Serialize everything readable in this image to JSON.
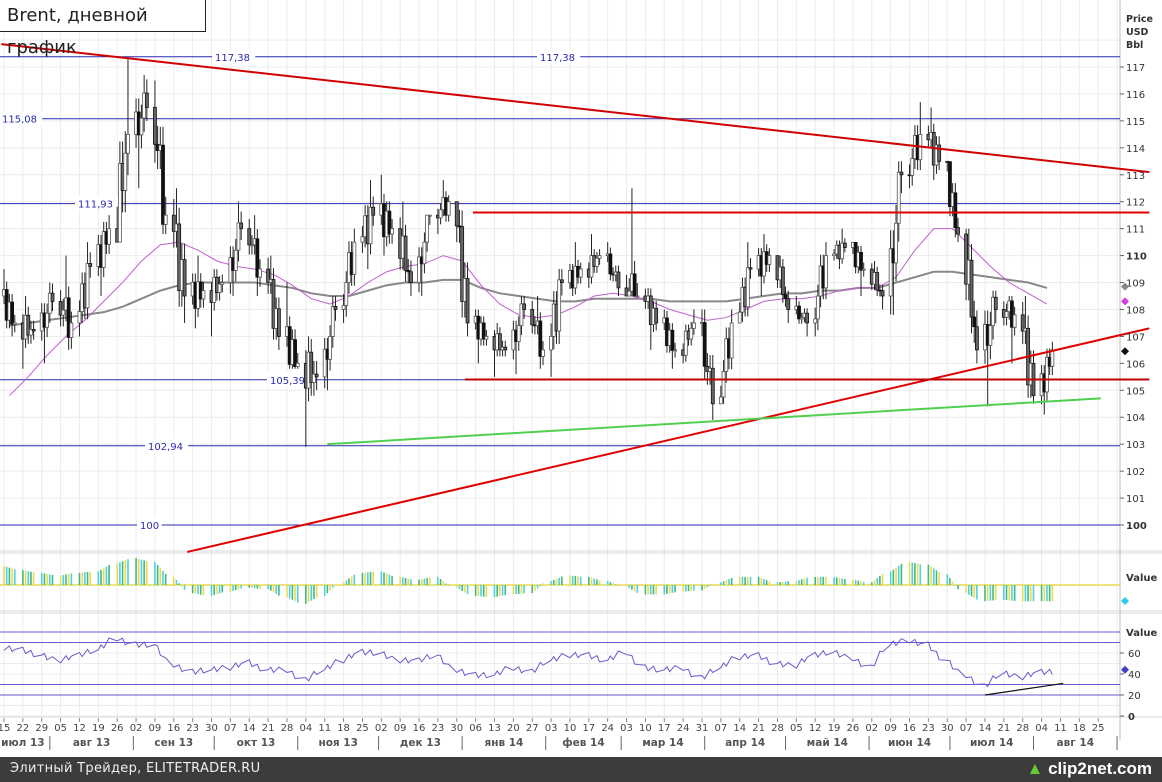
{
  "header": {
    "title": "Brent, дневной график"
  },
  "footer": {
    "source": "Элитный Трейдер, ELITETRADER.RU",
    "logo": "clip2net.com"
  },
  "chart_data": {
    "type": "candlestick",
    "title": "Brent, дневной график",
    "ylabel": "Price USD Bbl",
    "ylim": [
      99,
      118.5
    ],
    "y_ticks": [
      "117",
      "116",
      "115",
      "114",
      "113",
      "112",
      "111",
      "110",
      "109",
      "108",
      "107",
      "106",
      "105",
      "104",
      "103",
      "102",
      "101",
      "100"
    ],
    "start_week": "2013-07-15",
    "weekly_ohlc": [
      [
        108.5,
        109.5,
        107,
        107.5
      ],
      [
        107.5,
        108.5,
        105.8,
        107.2
      ],
      [
        107.2,
        109,
        106,
        108.3
      ],
      [
        108.3,
        110,
        106.5,
        107.5
      ],
      [
        107.5,
        110.5,
        107,
        109.6
      ],
      [
        109.6,
        111.5,
        108.5,
        111
      ],
      [
        111,
        117.3,
        110.5,
        114.5
      ],
      [
        114.5,
        116.7,
        112.5,
        115.5
      ],
      [
        115.5,
        116.5,
        110.8,
        111.5
      ],
      [
        111.5,
        112.5,
        107.5,
        108.5
      ],
      [
        108.5,
        110,
        107.3,
        108.7
      ],
      [
        108.7,
        109.5,
        107,
        109
      ],
      [
        109,
        112,
        108.5,
        111
      ],
      [
        111,
        111.5,
        108.5,
        109.5
      ],
      [
        109.5,
        110,
        106.5,
        107
      ],
      [
        107,
        109,
        105.8,
        106
      ],
      [
        106,
        107,
        102.9,
        105.5
      ],
      [
        105.5,
        108.5,
        105,
        108
      ],
      [
        108,
        111,
        107.5,
        110.5
      ],
      [
        110.5,
        112.8,
        109.5,
        111.5
      ],
      [
        111.5,
        113,
        110,
        111
      ],
      [
        111,
        112,
        108.5,
        109
      ],
      [
        109,
        111.5,
        108.5,
        111.5
      ],
      [
        111.5,
        112.8,
        110.8,
        112
      ],
      [
        112,
        112,
        107,
        107.5
      ],
      [
        107.5,
        108,
        106,
        107
      ],
      [
        107,
        107.5,
        105.5,
        106.5
      ],
      [
        106.5,
        108.5,
        105.6,
        108
      ],
      [
        108,
        108.5,
        105.8,
        106.5
      ],
      [
        106.5,
        109.5,
        105.5,
        109
      ],
      [
        109,
        110.5,
        108.5,
        109.5
      ],
      [
        109.5,
        110.8,
        108.8,
        110
      ],
      [
        110,
        110.5,
        108.5,
        108.8
      ],
      [
        108.8,
        112.5,
        108.5,
        108.5
      ],
      [
        108.5,
        108.8,
        106.5,
        107.5
      ],
      [
        107.5,
        108,
        105.8,
        106.5
      ],
      [
        106.5,
        108,
        106,
        107.5
      ],
      [
        107.5,
        108,
        103.9,
        104.5
      ],
      [
        104.5,
        108,
        104.5,
        107.5
      ],
      [
        107.5,
        110.5,
        107.5,
        109.5
      ],
      [
        109.5,
        110.8,
        108.5,
        110
      ],
      [
        110,
        110,
        107.5,
        108
      ],
      [
        108,
        108.5,
        107,
        107.5
      ],
      [
        107.5,
        110.5,
        107,
        110
      ],
      [
        110,
        111,
        109.5,
        110.3
      ],
      [
        110.3,
        110.5,
        108.5,
        109.5
      ],
      [
        109.5,
        109.8,
        108,
        108.5
      ],
      [
        108.5,
        113.5,
        107.8,
        113
      ],
      [
        113,
        115.7,
        112.5,
        114.5
      ],
      [
        114.5,
        115.5,
        112.8,
        113.5
      ],
      [
        113.5,
        113.5,
        110.5,
        110.8
      ],
      [
        110.8,
        111,
        106,
        106.5
      ],
      [
        106.5,
        108.7,
        104.4,
        108
      ],
      [
        108,
        108.5,
        106,
        107.8
      ],
      [
        107.8,
        108.5,
        104.5,
        104.8
      ],
      [
        104.8,
        106.8,
        104.1,
        106.5
      ]
    ],
    "ma_long_weekly": [
      107.4,
      107.5,
      107.6,
      107.7,
      107.8,
      107.9,
      108.1,
      108.4,
      108.7,
      108.9,
      109.0,
      109.0,
      109.0,
      109.0,
      108.9,
      108.8,
      108.6,
      108.5,
      108.5,
      108.7,
      108.9,
      109.0,
      109.0,
      109.1,
      109.1,
      108.8,
      108.6,
      108.5,
      108.4,
      108.3,
      108.3,
      108.4,
      108.4,
      108.4,
      108.4,
      108.3,
      108.3,
      108.3,
      108.3,
      108.4,
      108.5,
      108.6,
      108.6,
      108.7,
      108.7,
      108.8,
      108.8,
      109.0,
      109.2,
      109.4,
      109.4,
      109.3,
      109.2,
      109.1,
      109.0,
      108.8
    ],
    "ma_short_weekly": [
      104.8,
      105.5,
      106.3,
      107.0,
      107.6,
      108.3,
      109.0,
      109.8,
      110.4,
      110.5,
      110.2,
      109.8,
      109.6,
      109.5,
      109.3,
      108.9,
      108.4,
      108.2,
      108.5,
      109.0,
      109.4,
      109.6,
      109.7,
      110.0,
      109.8,
      108.9,
      108.2,
      107.8,
      107.7,
      107.8,
      108.1,
      108.5,
      108.6,
      108.5,
      108.3,
      108.0,
      107.8,
      107.6,
      107.7,
      108.0,
      108.3,
      108.4,
      108.4,
      108.5,
      108.7,
      108.8,
      108.8,
      109.2,
      110.2,
      111.0,
      111.0,
      110.3,
      109.6,
      109.0,
      108.6,
      108.2
    ],
    "levels": [
      {
        "value": 117.38,
        "labels": [
          "117,38",
          "117,38"
        ]
      },
      {
        "value": 115.08,
        "labels": [
          "115,08"
        ]
      },
      {
        "value": 111.93,
        "labels": [
          "111,93"
        ]
      },
      {
        "value": 105.39,
        "labels": [
          "105,39"
        ]
      },
      {
        "value": 102.94,
        "labels": [
          "102,94"
        ]
      },
      {
        "value": 100,
        "labels": [
          "100"
        ]
      }
    ],
    "trendlines": [
      {
        "name": "resistance-downtrend",
        "color": "#d00000",
        "from": [
          "2013-07-14",
          117.85
        ],
        "to": [
          "2014-09-13",
          113.1
        ]
      },
      {
        "name": "support-uptrend",
        "color": "#e00000",
        "from": [
          "2013-09-21",
          99.0
        ],
        "to": [
          "2014-09-13",
          107.3
        ]
      },
      {
        "name": "support-green",
        "color": "#50d050",
        "from": [
          "2013-11-12",
          103.0
        ],
        "to": [
          "2014-08-26",
          104.7
        ]
      },
      {
        "name": "resistance-horizontal",
        "color": "#e00000",
        "from": [
          "2014-01-05",
          111.6
        ],
        "to": [
          "2014-09-13",
          111.6
        ]
      },
      {
        "name": "support-horizontal",
        "color": "#c00000",
        "from": [
          "2014-01-02",
          105.4
        ],
        "to": [
          "2014-09-13",
          105.4
        ]
      }
    ],
    "oscillator": {
      "label": "Value",
      "weekly": [
        0.7,
        0.55,
        0.45,
        0.35,
        0.45,
        0.5,
        0.8,
        1.0,
        0.85,
        0.3,
        -0.3,
        -0.4,
        -0.25,
        -0.1,
        -0.15,
        -0.45,
        -0.7,
        -0.4,
        0.1,
        0.45,
        0.5,
        0.3,
        0.2,
        0.3,
        -0.1,
        -0.4,
        -0.45,
        -0.35,
        -0.3,
        0.15,
        0.35,
        0.3,
        0.15,
        -0.05,
        -0.35,
        -0.35,
        -0.25,
        -0.2,
        0.1,
        0.3,
        0.3,
        0.1,
        0.15,
        0.3,
        0.3,
        0.2,
        0.1,
        0.5,
        0.85,
        0.75,
        0.4,
        -0.3,
        -0.6,
        -0.55,
        -0.6,
        -0.6
      ]
    },
    "rsi": {
      "label": "Value",
      "ticks": [
        "60",
        "40",
        "20",
        "0"
      ],
      "levels": [
        80,
        70,
        30,
        20
      ],
      "weekly": [
        65,
        63,
        58,
        53,
        58,
        63,
        74,
        68,
        68,
        49,
        42,
        44,
        46,
        51,
        44,
        44,
        34,
        44,
        53,
        61,
        60,
        53,
        53,
        58,
        44,
        39,
        39,
        46,
        42,
        53,
        58,
        58,
        53,
        61,
        46,
        44,
        46,
        36,
        46,
        56,
        58,
        50,
        48,
        58,
        61,
        55,
        46,
        68,
        72,
        68,
        53,
        39,
        28,
        41,
        37,
        42
      ],
      "trendline": {
        "from": [
          "2014-07-14",
          20
        ],
        "to": [
          "2014-08-12",
          31
        ]
      }
    },
    "x_week_labels": [
      "15",
      "22",
      "29",
      "05",
      "12",
      "19",
      "26",
      "02",
      "09",
      "16",
      "23",
      "30",
      "07",
      "14",
      "21",
      "28",
      "04",
      "11",
      "18",
      "25",
      "02",
      "09",
      "16",
      "23",
      "30",
      "06",
      "13",
      "20",
      "27",
      "03",
      "10",
      "17",
      "24",
      "03",
      "10",
      "17",
      "24",
      "31",
      "07",
      "14",
      "21",
      "28",
      "05",
      "12",
      "19",
      "26",
      "02",
      "09",
      "16",
      "23",
      "30",
      "07",
      "14",
      "21",
      "28",
      "04",
      "11",
      "18",
      "25"
    ],
    "x_month_labels": [
      "июл 13",
      "авг 13",
      "сен 13",
      "окт 13",
      "ноя 13",
      "дек 13",
      "янв 14",
      "фев 14",
      "мар 14",
      "апр 14",
      "май 14",
      "июн 14",
      "июл 14",
      "авг 14"
    ],
    "colors": {
      "level": "#2a2ab0",
      "ma_long": "#888888",
      "ma_short": "#c060d0",
      "rsi": "#6a5acd",
      "osc": [
        "#e8dc50",
        "#50d0e0",
        "#40b880"
      ]
    }
  }
}
